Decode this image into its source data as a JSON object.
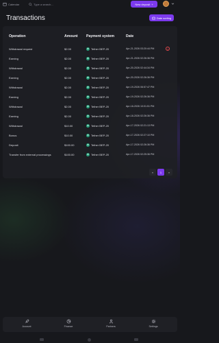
{
  "topbar": {
    "calendar_label": "Calendar",
    "search_placeholder": "Type a search...",
    "new_deposit_label": "New deposit"
  },
  "page": {
    "title": "Transactions",
    "sort_label": "Date sorting"
  },
  "table": {
    "headers": [
      "Operation",
      "Amount",
      "Payment system",
      "Date"
    ],
    "rows": [
      {
        "operation": "Withdrawal request",
        "amount": "$2.00",
        "system": "Tether BEP-20",
        "date": "Apr-21-2026 03:20:44 PM",
        "cancelable": true
      },
      {
        "operation": "Earning",
        "amount": "$2.00",
        "system": "Tether BEP-20",
        "date": "Apr-21-2026 02:26:36 PM",
        "cancelable": false
      },
      {
        "operation": "Withdrawal",
        "amount": "$2.00",
        "system": "Tether BEP-20",
        "date": "Apr-20-2026 02:44:34 PM",
        "cancelable": false
      },
      {
        "operation": "Earning",
        "amount": "$2.00",
        "system": "Tether BEP-20",
        "date": "Apr-20-2026 02:26:36 PM",
        "cancelable": false
      },
      {
        "operation": "Withdrawal",
        "amount": "$2.00",
        "system": "Tether BEP-20",
        "date": "Apr-19-2026 06:57:47 PM",
        "cancelable": false
      },
      {
        "operation": "Earning",
        "amount": "$2.00",
        "system": "Tether BEP-20",
        "date": "Apr-19-2026 02:26:36 PM",
        "cancelable": false
      },
      {
        "operation": "Withdrawal",
        "amount": "$2.00",
        "system": "Tether BEP-20",
        "date": "Apr-18-2026 10:01:51 PM",
        "cancelable": false
      },
      {
        "operation": "Earning",
        "amount": "$2.00",
        "system": "Tether BEP-20",
        "date": "Apr-18-2026 02:26:36 PM",
        "cancelable": false
      },
      {
        "operation": "Withdrawal",
        "amount": "$10.00",
        "system": "Tether BEP-20",
        "date": "Apr-17-2026 02:21:13 PM",
        "cancelable": false
      },
      {
        "operation": "Bonus",
        "amount": "$10.00",
        "system": "Tether BEP-20",
        "date": "Apr-17-2026 02:27:10 PM",
        "cancelable": false
      },
      {
        "operation": "Deposit",
        "amount": "$100.00",
        "system": "Tether BEP-20",
        "date": "Apr-17-2026 02:26:36 PM",
        "cancelable": false
      },
      {
        "operation": "Transfer from external processings",
        "amount": "$100.00",
        "system": "Tether BEP-20",
        "date": "Apr-17-2026 02:25:36 PM",
        "cancelable": false
      }
    ]
  },
  "pagination": {
    "prev": "«",
    "current": "1",
    "next": "»"
  },
  "bottom_nav": {
    "items": [
      {
        "label": "Account",
        "icon": "rocket-icon"
      },
      {
        "label": "Finance",
        "icon": "pie-chart-icon"
      },
      {
        "label": "Partners",
        "icon": "users-icon"
      },
      {
        "label": "Settings",
        "icon": "gear-icon"
      }
    ]
  },
  "colors": {
    "accent": "#7c3aed",
    "tether": "#26a17b",
    "danger": "#e5484d"
  }
}
